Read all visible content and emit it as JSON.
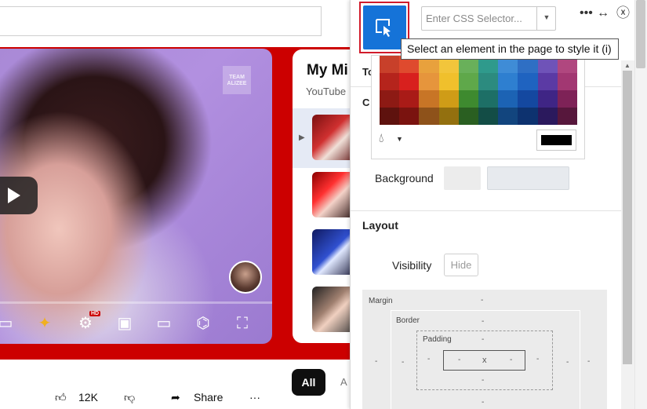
{
  "youtube": {
    "video_badge": "TEAM ALIZEE",
    "hd_badge": "HD",
    "playlist_title": "My Mi",
    "playlist_subtitle": "YouTube",
    "chip_all": "All",
    "chip_next": "A",
    "like_count": "12K",
    "share_label": "Share",
    "more_label": "···"
  },
  "styler": {
    "selector_placeholder": "Enter CSS Selector...",
    "tooltip": "Select an element in the page to style it (i)",
    "section_tab_partial": "To",
    "section_color_partial": "C",
    "background_label": "Background",
    "layout_heading": "Layout",
    "visibility_label": "Visibility",
    "hide_button": "Hide",
    "box_model": {
      "margin_label": "Margin",
      "border_label": "Border",
      "padding_label": "Padding",
      "dash": "-",
      "content": "x"
    },
    "selected_color": "#000000",
    "palette": [
      "#c8402a",
      "#df4a2e",
      "#e8a13d",
      "#f2c53b",
      "#69b05a",
      "#2f9a8c",
      "#3f8cd6",
      "#2f6fc4",
      "#6f53b8",
      "#b0477f",
      "#b5241c",
      "#d8201e",
      "#e6953c",
      "#f0c02c",
      "#5fa84a",
      "#2c8b7f",
      "#2e7fd0",
      "#1f63c0",
      "#5b3aa4",
      "#a23772",
      "#8d1a14",
      "#a91b17",
      "#c87526",
      "#cf9c17",
      "#3e8a2f",
      "#1d6f66",
      "#1c63b4",
      "#1448a0",
      "#3f2585",
      "#7e2257",
      "#5e120e",
      "#7a130f",
      "#8e521a",
      "#93700f",
      "#2a5f21",
      "#134d46",
      "#12457e",
      "#0d326f",
      "#2b195d",
      "#57173c"
    ]
  }
}
